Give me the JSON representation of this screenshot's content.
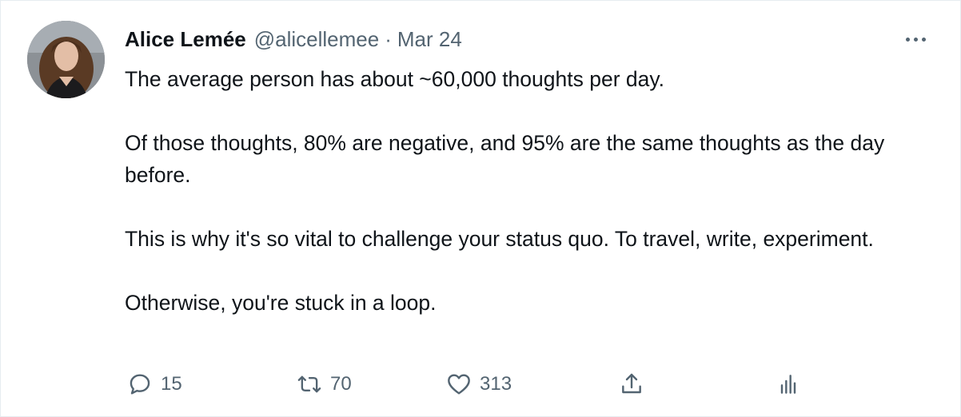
{
  "tweet": {
    "author": {
      "name": "Alice Lemée",
      "handle": "@alicellemee",
      "separator": "·",
      "date": "Mar 24"
    },
    "paragraphs": [
      "The average person has about ~60,000 thoughts per day.",
      "Of those thoughts, 80% are negative, and 95% are the same thoughts as the day before.",
      "This is why it's so vital to challenge your status quo. To travel, write, experiment.",
      "Otherwise, you're stuck in a loop."
    ],
    "actions": {
      "reply_count": "15",
      "retweet_count": "70",
      "like_count": "313"
    }
  },
  "icons": {
    "more": "more-icon",
    "reply": "reply-icon",
    "retweet": "retweet-icon",
    "like": "heart-icon",
    "share": "share-icon",
    "analytics": "analytics-icon"
  },
  "colors": {
    "text": "#0f1419",
    "secondary": "#536471",
    "border": "#e6ecf0"
  }
}
